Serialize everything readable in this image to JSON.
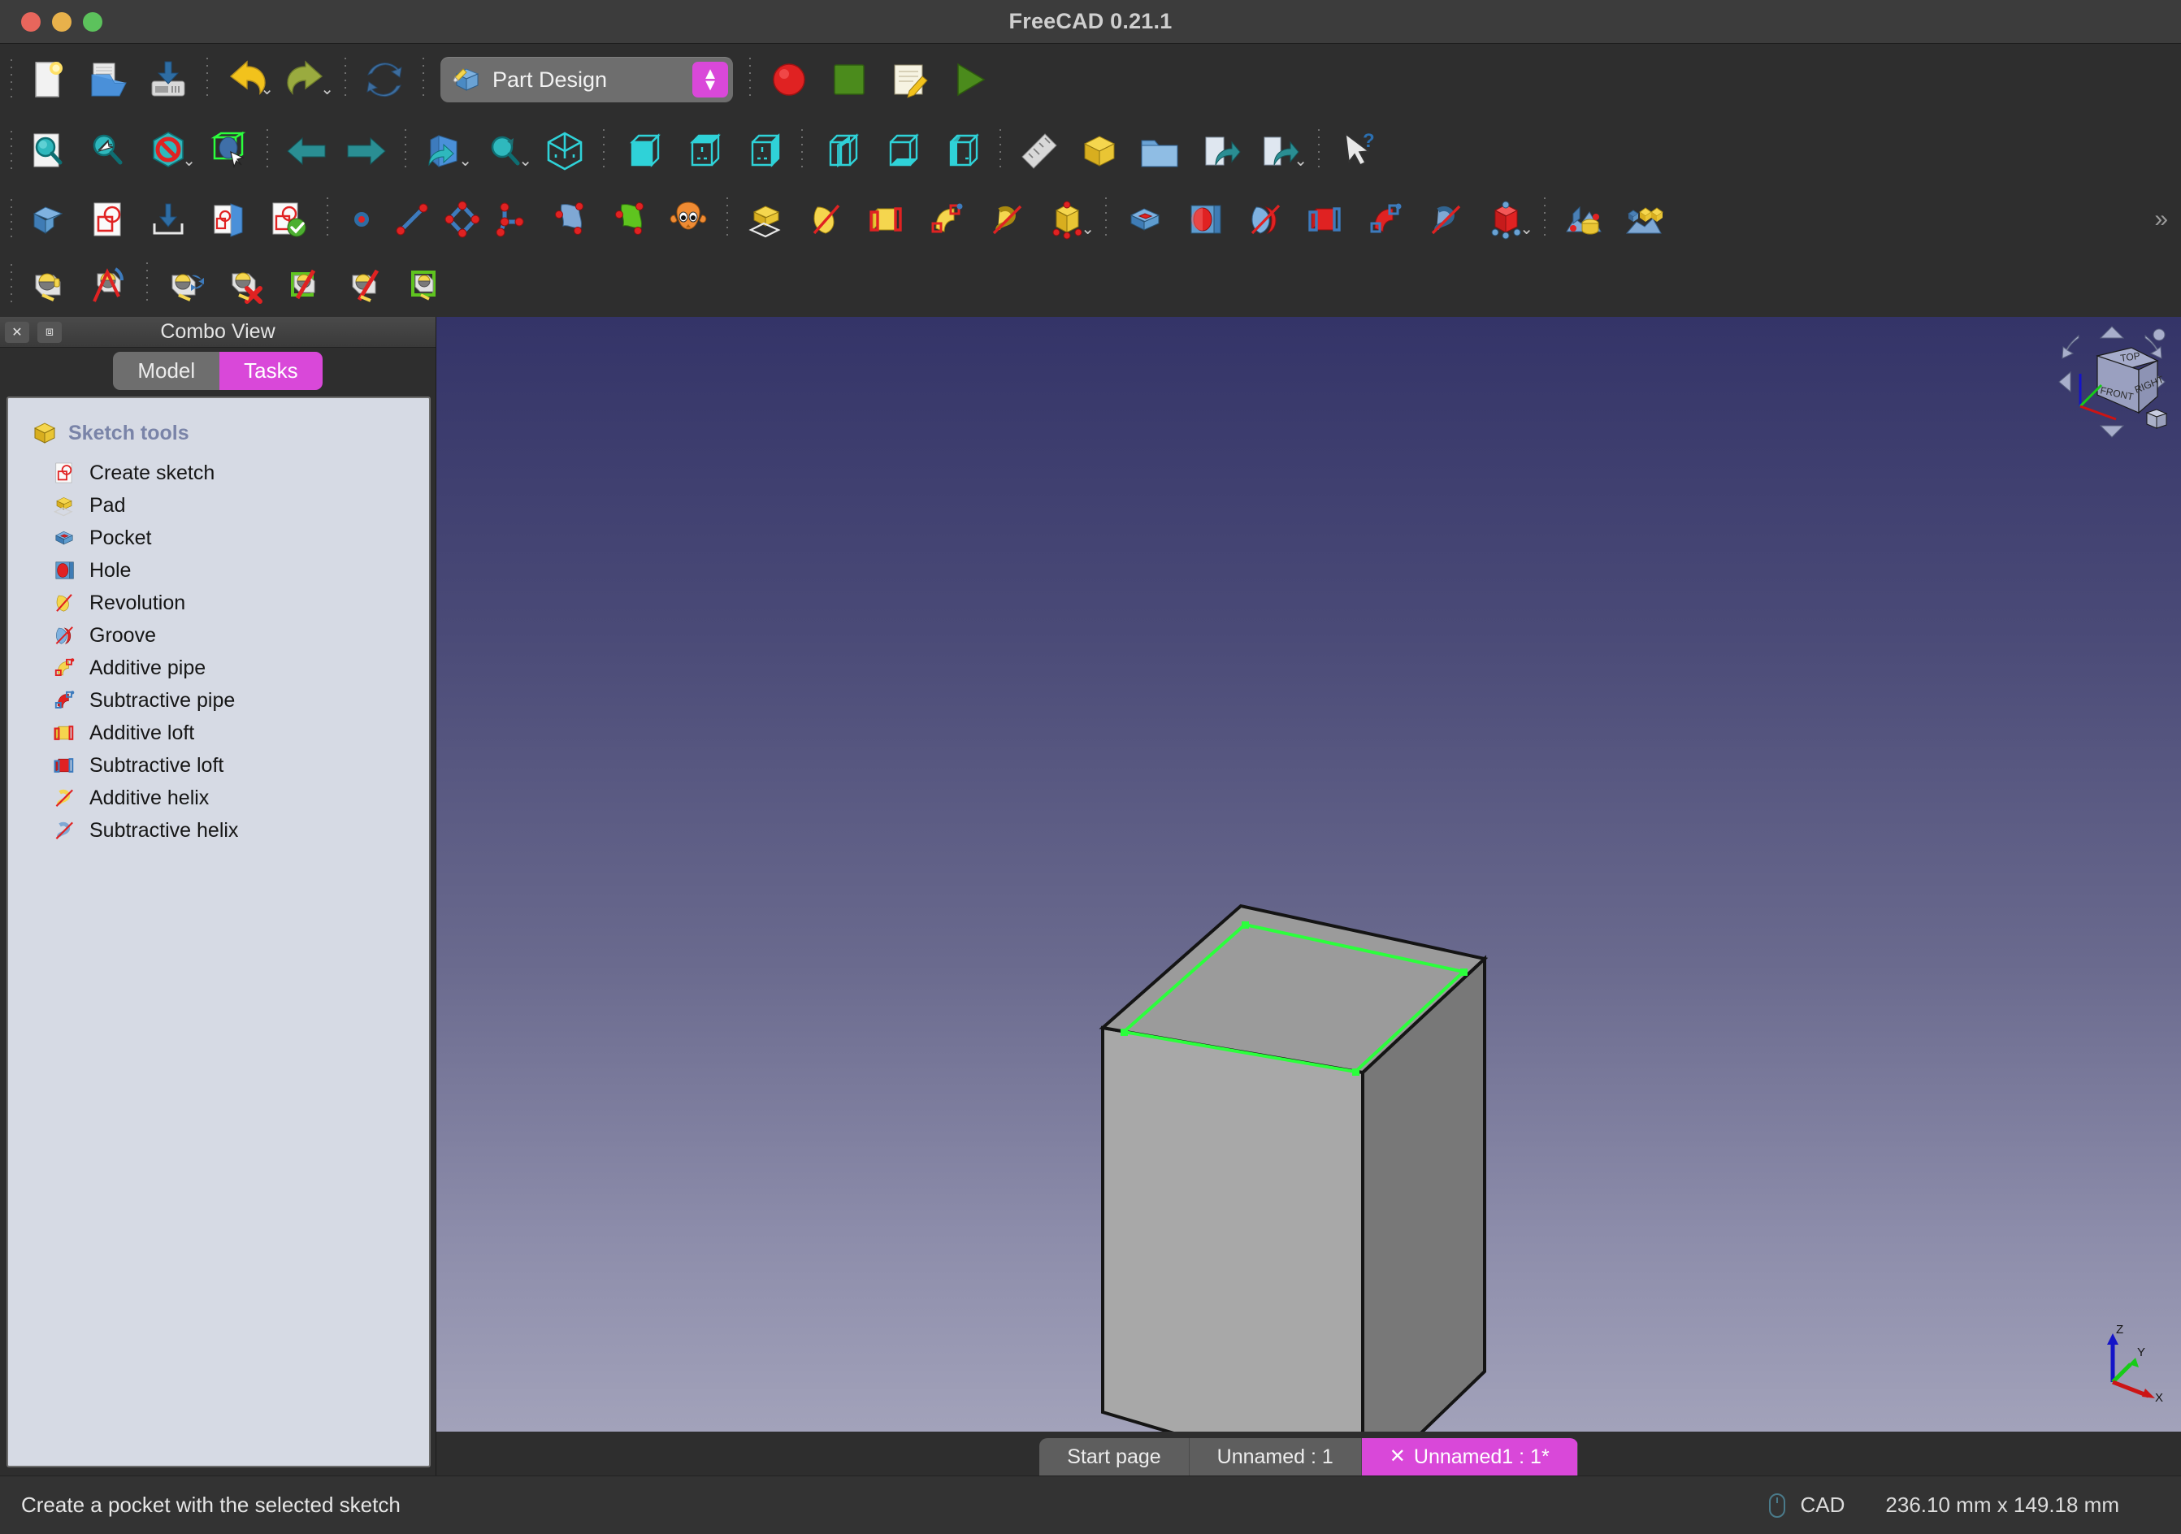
{
  "window": {
    "title": "FreeCAD 0.21.1",
    "controls": {
      "close": "close",
      "minimize": "minimize",
      "maximize": "maximize"
    }
  },
  "toolbar_file": {
    "buttons": [
      {
        "name": "new-document-button",
        "icon": "new-file-icon",
        "label": "New"
      },
      {
        "name": "open-document-button",
        "icon": "open-folder-icon",
        "label": "Open"
      },
      {
        "name": "save-document-button",
        "icon": "save-disk-icon",
        "label": "Save"
      },
      {
        "name": "undo-button",
        "icon": "undo-arrow-icon",
        "label": "Undo"
      },
      {
        "name": "redo-button",
        "icon": "redo-arrow-icon",
        "label": "Redo"
      },
      {
        "name": "refresh-button",
        "icon": "refresh-icon",
        "label": "Refresh"
      }
    ]
  },
  "workbench": {
    "name": "workbench-selector",
    "selected": "Part Design",
    "icon": "part-design-icon",
    "stepper": "stepper-updown"
  },
  "toolbar_macro": {
    "buttons": [
      {
        "name": "macro-record-button",
        "icon": "record-circle-icon",
        "label": "Macro recording"
      },
      {
        "name": "macro-stop-button",
        "icon": "stop-square-icon",
        "label": "Stop macro recording"
      },
      {
        "name": "macro-edit-button",
        "icon": "macro-edit-icon",
        "label": "Macros"
      },
      {
        "name": "macro-execute-button",
        "icon": "play-triangle-icon",
        "label": "Execute macro"
      }
    ]
  },
  "toolbar_view": {
    "buttons": [
      {
        "name": "fit-all-button",
        "icon": "fit-all-icon",
        "label": "Fit all"
      },
      {
        "name": "fit-selection-button",
        "icon": "fit-selection-icon",
        "label": "Fit selection"
      },
      {
        "name": "draw-style-button",
        "icon": "draw-style-icon",
        "label": "Draw style"
      },
      {
        "name": "box-selection-button",
        "icon": "box-selection-icon",
        "label": "Box selection"
      },
      {
        "name": "nav-back-button",
        "icon": "arrow-left-icon",
        "label": "Back"
      },
      {
        "name": "nav-forward-button",
        "icon": "arrow-right-icon",
        "label": "Forward"
      },
      {
        "name": "sync-view-button",
        "icon": "sync-view-icon",
        "label": "Sync view"
      },
      {
        "name": "zoom-select-button",
        "icon": "zoom-select-icon",
        "label": "Zoom"
      },
      {
        "name": "view-axonometric-button",
        "icon": "axonometric-cube-icon",
        "label": "Axonometric"
      },
      {
        "name": "view-front-button",
        "icon": "view-front-icon",
        "label": "Front"
      },
      {
        "name": "view-top-button",
        "icon": "view-top-icon",
        "label": "Top"
      },
      {
        "name": "view-right-button",
        "icon": "view-right-icon",
        "label": "Right"
      },
      {
        "name": "view-rear-button",
        "icon": "view-rear-icon",
        "label": "Rear"
      },
      {
        "name": "view-bottom-button",
        "icon": "view-bottom-icon",
        "label": "Bottom"
      },
      {
        "name": "view-left-button",
        "icon": "view-left-icon",
        "label": "Left"
      },
      {
        "name": "measure-button",
        "icon": "ruler-icon",
        "label": "Measure"
      },
      {
        "name": "create-part-button",
        "icon": "part-box-icon",
        "label": "Create part"
      },
      {
        "name": "create-group-button",
        "icon": "folder-icon",
        "label": "Create group"
      },
      {
        "name": "link-object-button",
        "icon": "link-arrow-icon",
        "label": "Make link"
      },
      {
        "name": "link-actions-button",
        "icon": "link-actions-icon",
        "label": "Link actions"
      },
      {
        "name": "whats-this-button",
        "icon": "whats-this-icon",
        "label": "What's this?"
      }
    ]
  },
  "toolbar_partdesign": {
    "buttons": [
      {
        "name": "create-body-button",
        "icon": "body-icon",
        "label": "Create body"
      },
      {
        "name": "create-sketch-button",
        "icon": "create-sketch-icon",
        "label": "Create sketch"
      },
      {
        "name": "attach-sketch-button",
        "icon": "attach-sketch-icon",
        "label": "Attach sketch"
      },
      {
        "name": "map-sketch-button",
        "icon": "map-sketch-icon",
        "label": "Map sketch to face"
      },
      {
        "name": "validate-sketch-button",
        "icon": "validate-sketch-icon",
        "label": "Validate sketch"
      },
      {
        "name": "create-point-button",
        "icon": "point-icon",
        "label": "Point"
      },
      {
        "name": "create-line-button",
        "icon": "line-icon",
        "label": "Line"
      },
      {
        "name": "create-polyline-button",
        "icon": "polyline-icon",
        "label": "Polyline"
      },
      {
        "name": "create-arc-button",
        "icon": "arc-icon",
        "label": "Arc"
      },
      {
        "name": "shapebinder-button",
        "icon": "shapebinder-blue-icon",
        "label": "Shape binder"
      },
      {
        "name": "subshapebinder-button",
        "icon": "shapebinder-green-icon",
        "label": "Sub-object shape binder"
      },
      {
        "name": "clone-button",
        "icon": "sheep-clone-icon",
        "label": "Clone"
      },
      {
        "name": "pad-button",
        "icon": "pad-icon",
        "label": "Pad"
      },
      {
        "name": "revolution-button",
        "icon": "revolution-icon",
        "label": "Revolution"
      },
      {
        "name": "additive-loft-button",
        "icon": "additive-loft-icon",
        "label": "Additive loft"
      },
      {
        "name": "additive-pipe-button",
        "icon": "additive-pipe-icon",
        "label": "Additive pipe"
      },
      {
        "name": "additive-helix-button",
        "icon": "additive-helix-icon",
        "label": "Additive helix"
      },
      {
        "name": "additive-primitive-button",
        "icon": "additive-primitive-icon",
        "label": "Additive primitive"
      },
      {
        "name": "pocket-button",
        "icon": "pocket-icon",
        "label": "Pocket"
      },
      {
        "name": "hole-button",
        "icon": "hole-icon",
        "label": "Hole"
      },
      {
        "name": "groove-button",
        "icon": "groove-icon",
        "label": "Groove"
      },
      {
        "name": "subtractive-loft-button",
        "icon": "subtractive-loft-icon",
        "label": "Subtractive loft"
      },
      {
        "name": "subtractive-pipe-button",
        "icon": "subtractive-pipe-icon",
        "label": "Subtractive pipe"
      },
      {
        "name": "subtractive-helix-button",
        "icon": "subtractive-helix-icon",
        "label": "Subtractive helix"
      },
      {
        "name": "subtractive-primitive-button",
        "icon": "subtractive-primitive-icon",
        "label": "Subtractive primitive"
      },
      {
        "name": "boolean-button",
        "icon": "boolean-icon",
        "label": "Boolean operation"
      },
      {
        "name": "pattern-button",
        "icon": "pattern-icon",
        "label": "Pattern"
      }
    ],
    "overflow": "»"
  },
  "toolbar_measure": {
    "buttons": [
      {
        "name": "measure-distance-button",
        "icon": "measure-tape-icon",
        "label": "Measure"
      },
      {
        "name": "measure-angle-button",
        "icon": "measure-angle-icon",
        "label": "Measure angle"
      },
      {
        "name": "measure-refresh-button",
        "icon": "measure-refresh-icon",
        "label": "Refresh measures"
      },
      {
        "name": "measure-clear-button",
        "icon": "measure-clear-icon",
        "label": "Clear all measures"
      },
      {
        "name": "measure-toggle-all-button",
        "icon": "measure-toggle-all-icon",
        "label": "Toggle all measures"
      },
      {
        "name": "measure-toggle-3d-button",
        "icon": "measure-toggle-3d-icon",
        "label": "Toggle 3D measures"
      },
      {
        "name": "measure-toggle-delta-button",
        "icon": "measure-toggle-delta-icon",
        "label": "Toggle delta measures"
      }
    ]
  },
  "combo_view": {
    "title": "Combo View",
    "close_icon": "close-icon",
    "float_icon": "undock-icon",
    "tabs": [
      {
        "label": "Model",
        "active": false
      },
      {
        "label": "Tasks",
        "active": true
      }
    ],
    "group": {
      "label": "Sketch tools",
      "icon": "yellow-box-icon"
    },
    "items": [
      {
        "label": "Create sketch",
        "icon": "create-sketch-icon"
      },
      {
        "label": "Pad",
        "icon": "pad-icon"
      },
      {
        "label": "Pocket",
        "icon": "pocket-icon"
      },
      {
        "label": "Hole",
        "icon": "hole-icon"
      },
      {
        "label": "Revolution",
        "icon": "revolution-icon"
      },
      {
        "label": "Groove",
        "icon": "groove-icon"
      },
      {
        "label": "Additive pipe",
        "icon": "additive-pipe-icon"
      },
      {
        "label": "Subtractive pipe",
        "icon": "subtractive-pipe-icon"
      },
      {
        "label": "Additive loft",
        "icon": "additive-loft-icon"
      },
      {
        "label": "Subtractive loft",
        "icon": "subtractive-loft-icon"
      },
      {
        "label": "Additive helix",
        "icon": "additive-helix-icon"
      },
      {
        "label": "Subtractive helix",
        "icon": "subtractive-helix-icon"
      }
    ]
  },
  "view3d": {
    "navigation_cube": {
      "faces": {
        "top": "TOP",
        "front": "FRONT",
        "right": "RIGHT"
      }
    },
    "axis_cross": {
      "x": "X",
      "y": "Y",
      "z": "Z"
    },
    "model": {
      "name": "box-solid",
      "selected_sketch_color": "#2bff3c",
      "face_light": "#b0b0b0",
      "face_top": "#9b9b9b",
      "face_dark": "#757575"
    },
    "background": {
      "top": "#343468",
      "bottom": "#a2a2ba"
    }
  },
  "document_tabs": [
    {
      "label": "Start page",
      "active": false,
      "closable": false
    },
    {
      "label": "Unnamed : 1",
      "active": false,
      "closable": false
    },
    {
      "label": "Unnamed1 : 1*",
      "active": true,
      "closable": true
    }
  ],
  "status_bar": {
    "message": "Create a pocket with the selected sketch",
    "navigation_style": "CAD",
    "navigation_icon": "mouse-icon",
    "dimensions": "236.10 mm x 149.18 mm"
  },
  "colors": {
    "accent": "#d948d9",
    "toolbar_bg": "#2e2e2e",
    "panel_bg": "#d6dae4"
  }
}
